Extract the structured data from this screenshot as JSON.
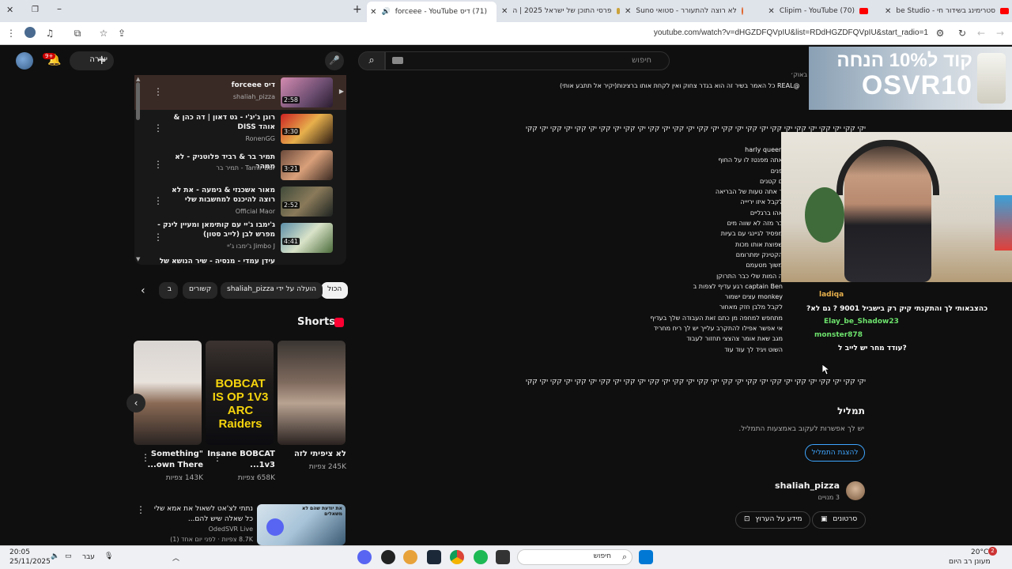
{
  "browser": {
    "tabs": [
      {
        "title": "סטרימינג בשידור חי - be Studio",
        "close": "✕"
      },
      {
        "title": "(70) Clipim - YouTube",
        "close": "✕"
      },
      {
        "title": "לא רוצה להתעורר - סטואי Suno",
        "close": "✕"
      },
      {
        "title": "פרסי התוכן של ישראל 2025 | ה",
        "close": "✕"
      },
      {
        "title": "(71) דיס forceee - YouTube",
        "close": "✕"
      }
    ],
    "url": "youtube.com/watch?v=dHGZDFQVpIU&list=RDdHGZDFQVpIU&start_radio=1"
  },
  "yt_header": {
    "search_placeholder": "חיפוש",
    "create_label": "יצירה",
    "bell_badge": "9+"
  },
  "playlist": [
    {
      "title": "דיס forceee",
      "channel": "shaliah_pizza",
      "duration": "2:58",
      "current": true
    },
    {
      "title": "רונן ג'יג'י - גט דאון | דה כהן & אוהד DISS",
      "channel": "RonenGG",
      "duration": "3:30"
    },
    {
      "title": "תמיר בר & רביד פלוטניק - לא ממהר",
      "channel": "Tamir Bar - תמיר בר",
      "duration": "3:21"
    },
    {
      "title": "מאור אשכנזי & גימעה - את לא רוצה להיכנס למחשבות שלי",
      "channel": "Official Maor",
      "duration": "2:52"
    },
    {
      "title": "ג'ימבו ג'יי עם קותימאן ומעיין לינק - מפרש לבן (לייב סטון)",
      "channel": "Jimbo J ג'ימבו ג'יי",
      "duration": "4:41"
    },
    {
      "title": "עידן עמדי - מנסיה - שיר הנושא של",
      "channel": "",
      "duration": ""
    }
  ],
  "chips": [
    {
      "label": "הכול",
      "selected": true
    },
    {
      "label": "הועלה על ידי shaliah_pizza"
    },
    {
      "label": "קשורים"
    },
    {
      "label": "ב"
    }
  ],
  "shorts": {
    "title": "Shorts",
    "items": [
      {
        "title": "לא ציפיתי לזה",
        "views": "245K צפיות"
      },
      {
        "title": "Insane BOBCAT 1v3...",
        "views": "658K צפיות",
        "thumb_text": "BOBCAT IS OP 1V3 ARC Raiders"
      },
      {
        "title": "Something\" own There...",
        "views": "143K צפיות"
      }
    ]
  },
  "bottom_video": {
    "title": "נתתי לצ'אט לשאול את אמא שלי כל שאלה שיש להם...",
    "channel": "OdedSVR Live",
    "meta": "8.7K צפיות · לפני יום אחד (1)",
    "thumb_text": "את יודעת שהם לא משאלים"
  },
  "description": {
    "date_line": "2025 18 באוק׳",
    "line1": "@REAL כל האמר בשיר זה הוא בגדר צחוק ואין לקחת אותו ברצינות(יקיר אל תתבע אותי)",
    "ticker": "יקי קקי יקי קקי יקי קקי יקי קקי יקי קקי יקי קקי יקי קקי יקי קקי יקי קקי יקי קקי יקי קקי יקי קקי יקי קקי יקי קקי יקי קקי יקי קקי יקי קקי יקי קקי יקי קקי",
    "lyrics": [
      "harly queen",
      "אתה מפנטז לו על החוף",
      "פנים",
      "ם קטנים",
      "ר אתה טעות של הבריאה",
      "לקבל איזו יריייה",
      "אהו ברגליים",
      "בר מזה לא שווה מים",
      "מפסיד לגיינגי עם בעיות",
      "שפוצת אותו מכות",
      "הקטינק ימתרומם",
      "משוך מטעמם",
      "ה המות שלי כבר התרוקן",
      "captain Ben רגע עדיף לצפות ב",
      "monkey עצים  ישמור",
      "לקבל מלבן חזק מאחור",
      "מתחפש למחפה מן כתם זאת העבודה שלך בעדיף",
      "אי אפשר אפילו להתקרב עלייך יש לך ריח מחריד",
      "מגב שאת אומר צהצצי תחזור לעבוד",
      "השוט ויגיד לך עוד עוד"
    ]
  },
  "stream_alerts": [
    {
      "user": "ladiqa",
      "text": ": "
    },
    {
      "user": "",
      "text": "כהצבאותי לך והתקנתי קיק רק בישביל 9001 ? גם לא?"
    },
    {
      "user": "Elay_be_Shadow23",
      "text": ":"
    },
    {
      "user": "monster878",
      "text": ":"
    },
    {
      "user": "",
      "text": "?עודד מחר יש לייב ל"
    }
  ],
  "transcript": {
    "title": "תמליל",
    "subtitle": "יש לך אפשרות לעקוב באמצעות התמליל.",
    "button": "להצגת התמליל"
  },
  "channel": {
    "name": "shaliah_pizza",
    "subs": "3 מנויים",
    "videos_btn": "סרטונים",
    "about_btn": "מידע על הערוץ"
  },
  "ad": {
    "line1": "קוד ל10% הנחה",
    "line2": "OSVR10"
  },
  "taskbar": {
    "time": "20:05",
    "date": "25/11/2025",
    "lang": "עבר",
    "search": "חיפוש",
    "weather_temp": "20°C",
    "weather_desc": "מעונן רב היום",
    "notif": "2"
  },
  "colors": {
    "bg": "#0f0f0f",
    "accent_blue": "#3ea6ff",
    "yt_red": "#ff0000"
  }
}
